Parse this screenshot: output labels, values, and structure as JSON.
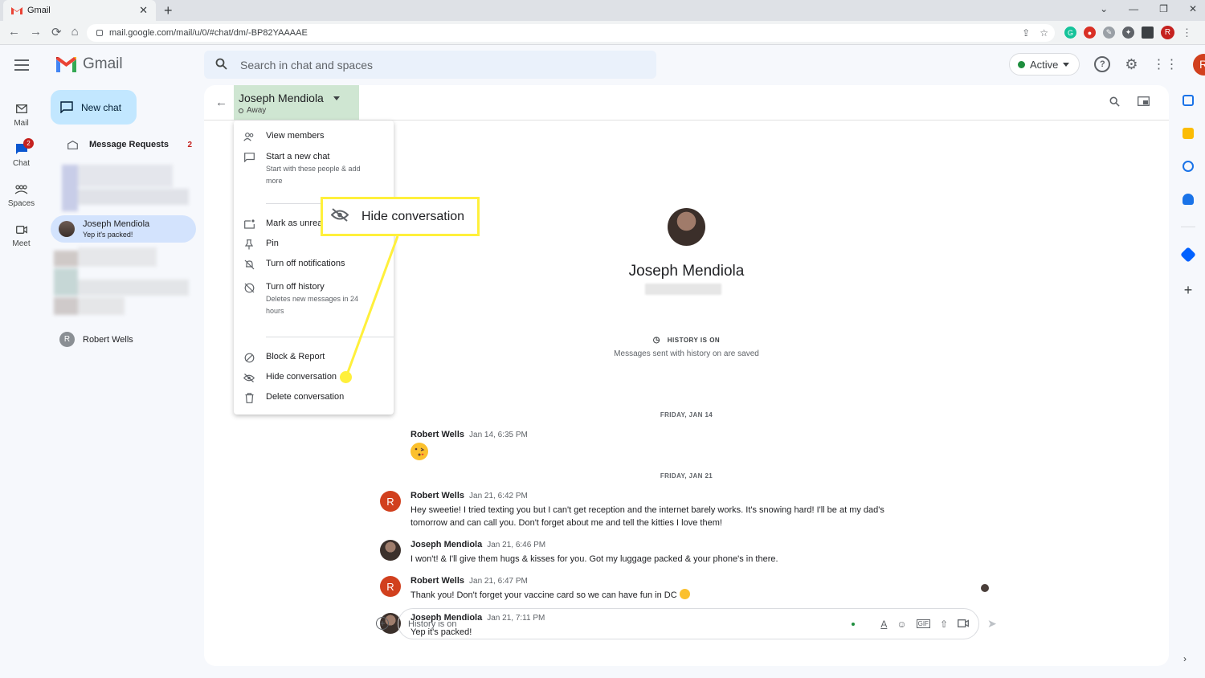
{
  "browser": {
    "tab_title": "Gmail",
    "tab_close": "✕",
    "new_tab": "+",
    "url": "mail.google.com/mail/u/0/#chat/dm/-BP82YAAAAE",
    "profile_letter": "R",
    "window_controls": [
      "⌄",
      "—",
      "❐",
      "✕"
    ],
    "nav_icons": [
      "←",
      "→",
      "⟳",
      "⌂"
    ]
  },
  "gmail": {
    "app_name": "Gmail",
    "search_placeholder": "Search in chat and spaces",
    "status_label": "Active",
    "account_letter": "R"
  },
  "rail": [
    {
      "label": "Mail",
      "icon": "mail-icon"
    },
    {
      "label": "Chat",
      "icon": "chat-icon",
      "badge": "2"
    },
    {
      "label": "Spaces",
      "icon": "spaces-icon"
    },
    {
      "label": "Meet",
      "icon": "meet-icon"
    }
  ],
  "chat_list": {
    "new_chat": "New chat",
    "message_requests": "Message Requests",
    "message_requests_count": "2",
    "selected": {
      "name": "Joseph Mendiola",
      "preview": "Yep it's packed!"
    },
    "other": {
      "name": "Robert Wells",
      "initial": "R"
    }
  },
  "header": {
    "name": "Joseph Mendiola",
    "status": "Away"
  },
  "menu": {
    "view_members": "View members",
    "start_new_chat": "Start a new chat",
    "start_new_chat_sub": "Start with these people & add more",
    "mark_unread": "Mark as unread",
    "pin": "Pin",
    "turn_off_notifications": "Turn off notifications",
    "turn_off_history": "Turn off history",
    "turn_off_history_sub": "Deletes new messages in 24 hours",
    "block_report": "Block & Report",
    "hide_conversation": "Hide conversation",
    "delete_conversation": "Delete conversation"
  },
  "callout": {
    "label": "Hide conversation",
    "color": "#fff03b"
  },
  "conversation": {
    "contact_name": "Joseph Mendiola",
    "history_label": "HISTORY IS ON",
    "history_sub": "Messages sent with history on are saved",
    "date1": "FRIDAY, JAN 14",
    "date2": "FRIDAY, JAN 21",
    "messages": [
      {
        "sender": "Robert Wells",
        "time": "Jan 14, 6:35 PM",
        "text": ""
      },
      {
        "sender": "Robert Wells",
        "time": "Jan 21, 6:42 PM",
        "text": "Hey sweetie! I tried texting you but I can't get reception and the internet barely works. It's snowing hard! I'll be at my dad's tomorrow and can call you. Don't forget about me and tell the kitties I love them!"
      },
      {
        "sender": "Joseph Mendiola",
        "time": "Jan 21, 6:46 PM",
        "text": "I won't! & I'll give them hugs & kisses for you. Got my luggage packed & your phone's in there."
      },
      {
        "sender": "Robert Wells",
        "time": "Jan 21, 6:47 PM",
        "text": "Thank you! Don't forget your vaccine card so we can have fun in DC"
      },
      {
        "sender": "Joseph Mendiola",
        "time": "Jan 21, 7:11 PM",
        "text": "Yep it's packed!"
      }
    ],
    "composer_placeholder": "History is on"
  },
  "colors": {
    "accent": "#c2e7ff",
    "selected_chat": "#d3e3fd",
    "header_highlight": "#cfe6d2",
    "avatar_red": "#d1401e"
  }
}
